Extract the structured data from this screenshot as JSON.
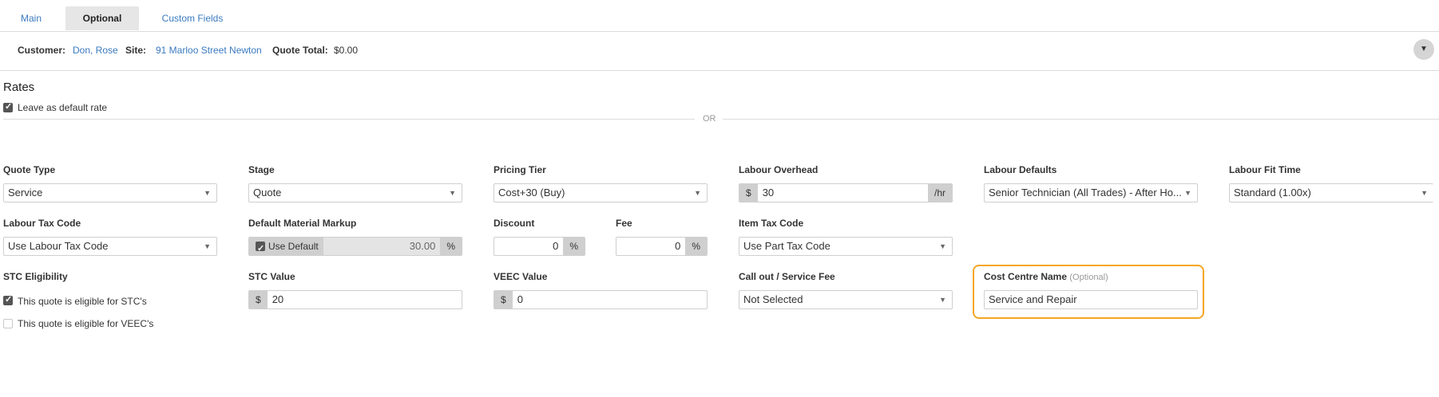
{
  "tabs": [
    {
      "label": "Main",
      "active": false
    },
    {
      "label": "Optional",
      "active": true
    },
    {
      "label": "Custom Fields",
      "active": false
    }
  ],
  "info": {
    "customer_label": "Customer:",
    "customer_value": "Don, Rose",
    "site_label": "Site:",
    "site_value": "91 Marloo Street Newton",
    "total_label": "Quote Total:",
    "total_value": "$0.00",
    "toggle_icon": "chevron-down-icon"
  },
  "rates": {
    "title": "Rates",
    "default_rate_label": "Leave as default rate",
    "default_rate_checked": true,
    "or_text": "OR"
  },
  "fields": {
    "quote_type": {
      "label": "Quote Type",
      "value": "Service"
    },
    "stage": {
      "label": "Stage",
      "value": "Quote"
    },
    "pricing_tier": {
      "label": "Pricing Tier",
      "value": "Cost+30 (Buy)"
    },
    "labour_overhead": {
      "label": "Labour Overhead",
      "prefix": "$",
      "value": "30",
      "suffix": "/hr"
    },
    "labour_defaults": {
      "label": "Labour Defaults",
      "value": "Senior Technician (All Trades) - After Ho..."
    },
    "labour_fit_time": {
      "label": "Labour Fit Time",
      "value": "Standard (1.00x)"
    },
    "labour_tax_code": {
      "label": "Labour Tax Code",
      "value": "Use Labour Tax Code"
    },
    "default_material_markup": {
      "label": "Default Material Markup",
      "use_default_label": "Use Default",
      "use_default_checked": true,
      "value": "30.00",
      "suffix": "%"
    },
    "discount": {
      "label": "Discount",
      "value": "0",
      "suffix": "%"
    },
    "fee": {
      "label": "Fee",
      "value": "0",
      "suffix": "%"
    },
    "item_tax_code": {
      "label": "Item Tax Code",
      "value": "Use Part Tax Code"
    },
    "stc_eligibility": {
      "label": "STC Eligibility",
      "stc_label": "This quote is eligible for STC's",
      "stc_checked": true,
      "veec_label": "This quote is eligible for VEEC's",
      "veec_checked": false
    },
    "stc_value": {
      "label": "STC Value",
      "prefix": "$",
      "value": "20"
    },
    "veec_value": {
      "label": "VEEC Value",
      "prefix": "$",
      "value": "0"
    },
    "callout_fee": {
      "label": "Call out / Service Fee",
      "value": "Not Selected"
    },
    "cost_centre_name": {
      "label": "Cost Centre Name",
      "optional": "(Optional)",
      "value": "Service and Repair"
    }
  },
  "colors": {
    "accent": "#3a7abf",
    "highlight": "#f5a623"
  }
}
